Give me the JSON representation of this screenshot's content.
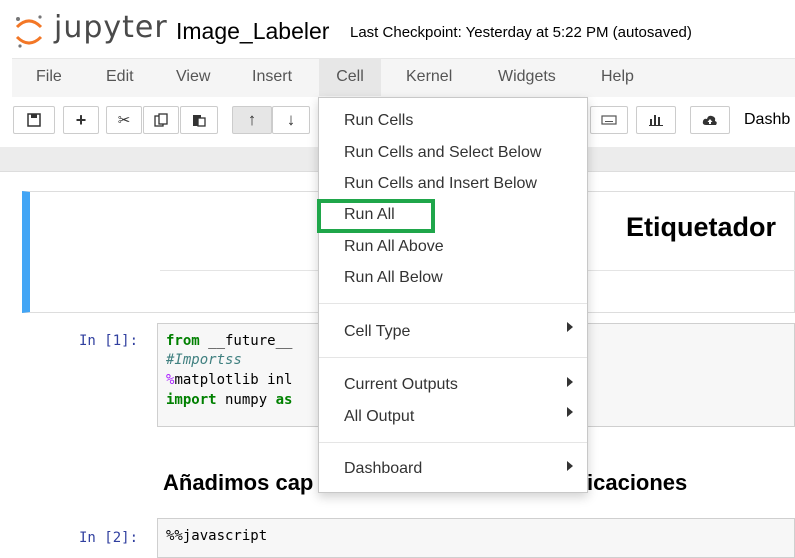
{
  "header": {
    "logo_text": "jupyter",
    "notebook_name": "Image_Labeler",
    "checkpoint": "Last Checkpoint: Yesterday at 5:22 PM (autosaved)"
  },
  "menubar": {
    "items": [
      "File",
      "Edit",
      "View",
      "Insert",
      "Cell",
      "Kernel",
      "Widgets",
      "Help"
    ],
    "active": "Cell"
  },
  "toolbar": {
    "dashboard_label": "Dashb"
  },
  "cell_menu": {
    "run_cells": "Run Cells",
    "run_select_below": "Run Cells and Select Below",
    "run_insert_below": "Run Cells and Insert Below",
    "run_all": "Run All",
    "run_all_above": "Run All Above",
    "run_all_below": "Run All Below",
    "cell_type": "Cell Type",
    "current_outputs": "Current Outputs",
    "all_output": "All Output",
    "dashboard": "Dashboard",
    "highlight_color": "#1fa64a"
  },
  "cells": {
    "md_heading": "Etiquetador",
    "cell1_prompt": "In [1]:",
    "cell1_line1_kw": "from",
    "cell1_line1_rest": " __future__",
    "cell1_line2": "#Importss",
    "cell1_line3_mg": "%",
    "cell1_line3_rest": "matplotlib inl",
    "cell1_line4_kw": "import",
    "cell1_line4_rest": " numpy ",
    "cell1_line4_kw2": "as",
    "section_left": "Añadimos cap",
    "section_right": "icaciones",
    "cell2_prompt": "In [2]:",
    "cell2_line1": "%%javascript"
  },
  "colors": {
    "accent_blue": "#42a5f5",
    "menubar_bg": "#f5f5f5"
  }
}
